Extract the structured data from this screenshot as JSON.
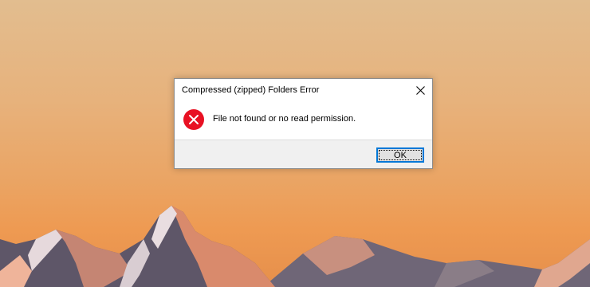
{
  "dialog": {
    "title": "Compressed (zipped) Folders Error",
    "message": "File not found or no read permission.",
    "ok_label": "OK",
    "close_icon": "close-icon",
    "status_icon": "error-icon"
  },
  "colors": {
    "error_red": "#e81123",
    "focus_blue": "#0078d7"
  }
}
